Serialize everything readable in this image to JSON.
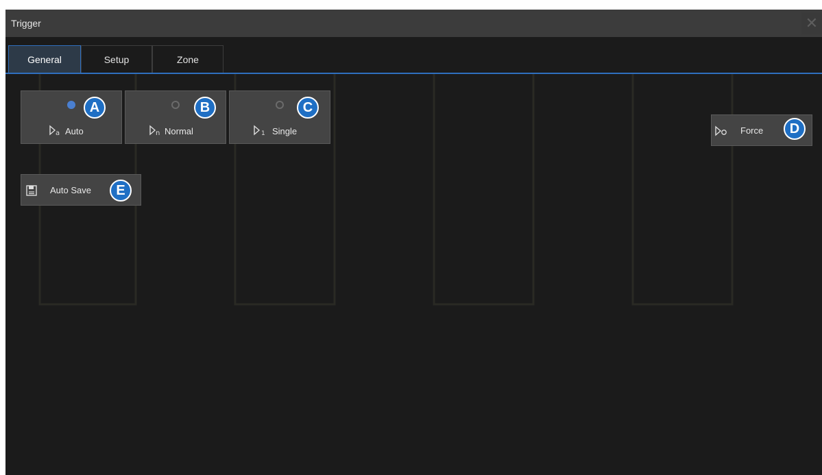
{
  "window": {
    "title": "Trigger",
    "close_glyph": "✕"
  },
  "tabs": [
    {
      "label": "General",
      "active": true
    },
    {
      "label": "Setup",
      "active": false
    },
    {
      "label": "Zone",
      "active": false
    }
  ],
  "modes": [
    {
      "label": "Auto",
      "selected": true,
      "icon": "trigger-auto-icon",
      "callout": "A"
    },
    {
      "label": "Normal",
      "selected": false,
      "icon": "trigger-normal-icon",
      "callout": "B"
    },
    {
      "label": "Single",
      "selected": false,
      "icon": "trigger-single-icon",
      "callout": "C"
    }
  ],
  "force": {
    "label": "Force",
    "icon": "trigger-force-icon",
    "callout": "D"
  },
  "auto_save": {
    "label": "Auto Save",
    "icon": "save-icon",
    "callout": "E"
  },
  "colors": {
    "accent": "#2f6fbf",
    "callout": "#1f6fc4",
    "button": "#444444",
    "background": "#1b1b1b"
  }
}
